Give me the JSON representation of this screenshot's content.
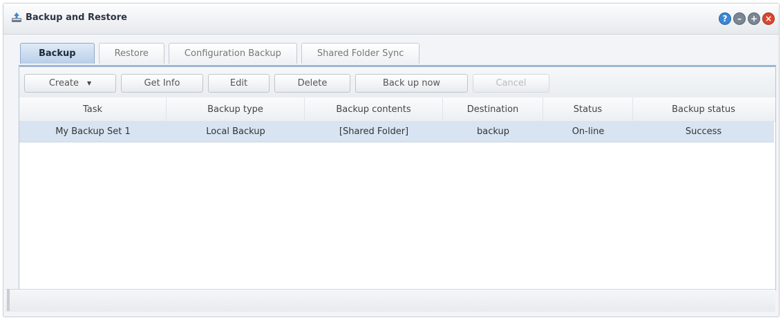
{
  "window": {
    "title": "Backup and Restore",
    "controls": [
      {
        "name": "help",
        "glyph": "?",
        "color": "#3a87d6"
      },
      {
        "name": "minimize",
        "glyph": "–",
        "color": "#7a8694"
      },
      {
        "name": "maximize",
        "glyph": "+",
        "color": "#7a8694"
      },
      {
        "name": "close",
        "glyph": "×",
        "color": "#d9462e"
      }
    ]
  },
  "tabs": [
    {
      "label": "Backup",
      "active": true
    },
    {
      "label": "Restore",
      "active": false
    },
    {
      "label": "Configuration Backup",
      "active": false
    },
    {
      "label": "Shared Folder Sync",
      "active": false
    }
  ],
  "toolbar": {
    "create_label": "Create",
    "get_info_label": "Get Info",
    "edit_label": "Edit",
    "delete_label": "Delete",
    "back_up_now_label": "Back up now",
    "cancel_label": "Cancel"
  },
  "table": {
    "columns": [
      "Task",
      "Backup type",
      "Backup contents",
      "Destination",
      "Status",
      "Backup status"
    ],
    "rows": [
      [
        "My Backup Set 1",
        "Local Backup",
        "[Shared Folder]",
        "backup",
        "On-line",
        "Success"
      ]
    ]
  }
}
